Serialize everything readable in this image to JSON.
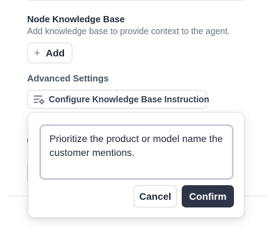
{
  "knowledge_base": {
    "title": "Node Knowledge Base",
    "description": "Add knowledge base to provide context to the agent.",
    "add_button": {
      "label": "Add",
      "icon": "plus-icon"
    }
  },
  "advanced_settings": {
    "title": "Advanced Settings",
    "configure_button": {
      "label": "Configure Knowledge Base Instruction",
      "icon": "settings-list-icon"
    }
  },
  "instruction_popover": {
    "instruction_value": "Prioritize the product or model name the customer mentions.",
    "cancel_label": "Cancel",
    "confirm_label": "Confirm"
  },
  "colors": {
    "primary_button": "#2d3547",
    "textarea_focus_border": "#c8c5dc",
    "muted_text": "#6b7280"
  }
}
